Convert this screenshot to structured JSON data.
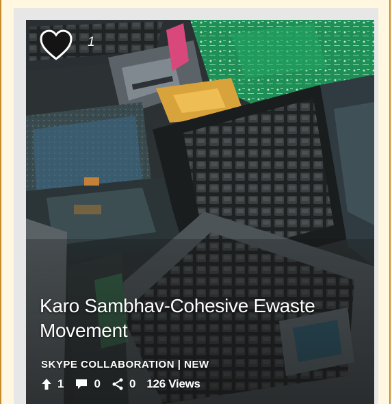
{
  "card": {
    "like_count": "1",
    "title": "Karo Sambhav-Cohesive Ewaste Movement",
    "category": "SKYPE COLLABORATION",
    "separator": "|",
    "status": "NEW",
    "stats": {
      "upvotes": "1",
      "comments": "0",
      "shares": "0",
      "views": "126 Views"
    }
  },
  "colors": {
    "page_background": "#fff7e0",
    "frame_border": "#c58b2b",
    "card_background": "#e7e7e7",
    "text": "#ffffff"
  },
  "icons": {
    "like": "heart-icon",
    "upvote": "arrow-up-icon",
    "comment": "speech-bubble-icon",
    "share": "share-icon"
  }
}
